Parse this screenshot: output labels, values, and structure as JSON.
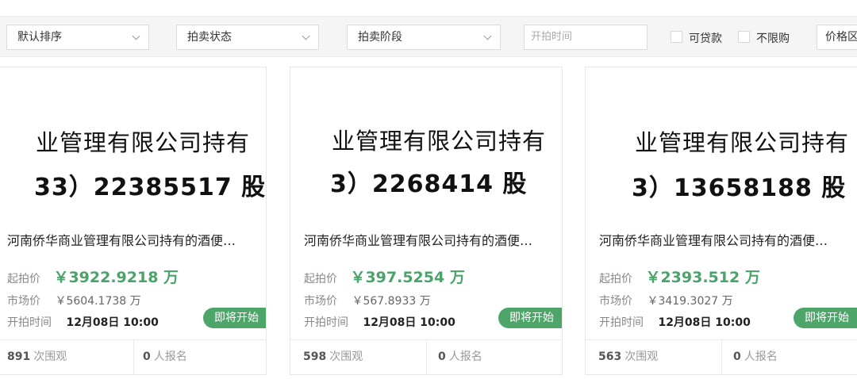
{
  "filters": {
    "sort": "默认排序",
    "auction_status": "拍卖状态",
    "auction_stage": "拍卖阶段",
    "start_time_placeholder": "开拍时间",
    "loan_label": "可贷款",
    "no_limit_label": "不限购",
    "price_range": "价格区"
  },
  "cards": [
    {
      "thumb_line1": "业管理有限公司持有",
      "thumb_line2": "33）22385517 股",
      "title": "河南侨华商业管理有限公司持有的酒便…",
      "start_label": "起拍价",
      "start_price": "￥3922.9218 万",
      "market_label": "市场价",
      "market_price": "￥5604.1738 万",
      "time_label": "开拍时间",
      "time_value": "12月08日 10:00",
      "badge": "即将开始",
      "views_num": "891",
      "views_label": "次围观",
      "signups_num": "0",
      "signups_label": "人报名"
    },
    {
      "thumb_line1": "业管理有限公司持有",
      "thumb_line2": "3）2268414 股",
      "title": "河南侨华商业管理有限公司持有的酒便…",
      "start_label": "起拍价",
      "start_price": "￥397.5254 万",
      "market_label": "市场价",
      "market_price": "￥567.8933 万",
      "time_label": "开拍时间",
      "time_value": "12月08日 10:00",
      "badge": "即将开始",
      "views_num": "598",
      "views_label": "次围观",
      "signups_num": "0",
      "signups_label": "人报名"
    },
    {
      "thumb_line1": "业管理有限公司持有",
      "thumb_line2": "3）13658188 股",
      "title": "河南侨华商业管理有限公司持有的酒便…",
      "start_label": "起拍价",
      "start_price": "￥2393.512 万",
      "market_label": "市场价",
      "market_price": "￥3419.3027 万",
      "time_label": "开拍时间",
      "time_value": "12月08日 10:00",
      "badge": "即将开始",
      "views_num": "563",
      "views_label": "次围观",
      "signups_num": "0",
      "signups_label": "人报名"
    }
  ]
}
